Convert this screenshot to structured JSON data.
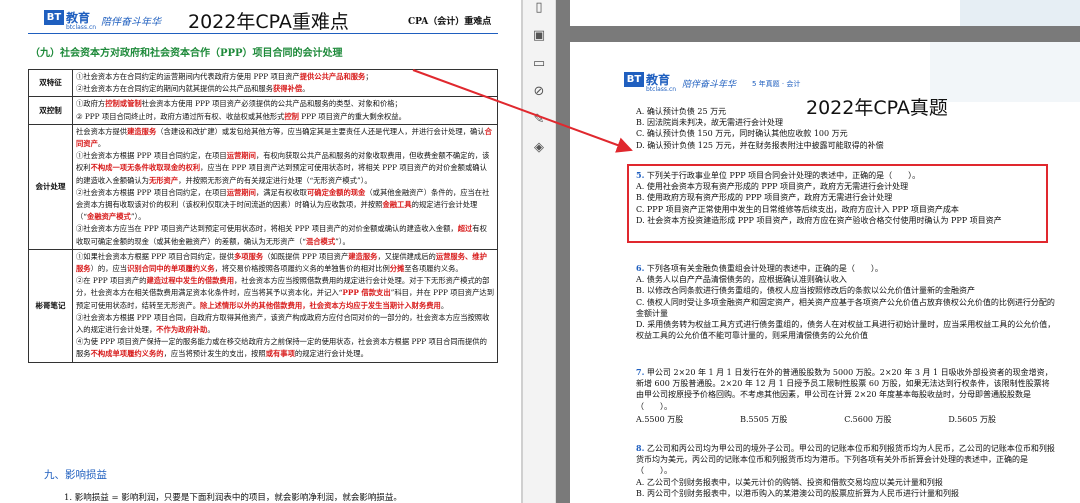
{
  "left_page": {
    "logo_mark": "BT",
    "logo_text": "教育",
    "logo_url": "btclass.cn",
    "slogan": "陪伴奋斗年华",
    "overlay_title": "2022年CPA重难点",
    "course_label": "CPA（会计）重难点",
    "section_title": "（九）社会资本方对政府和社会资本合作（PPP）项目合同的会计处理",
    "rows": [
      {
        "head": "双特征",
        "lines": [
          [
            {
              "t": "①社会资本方在合同约定的运营期间内代表政府方使用 PPP 项目资产"
            },
            {
              "t": "提供公共产品和服务",
              "r": true
            },
            {
              "t": "；"
            }
          ],
          [
            {
              "t": "②社会资本方在合同约定的期间内就其提供的公共产品和服务"
            },
            {
              "t": "获得补偿",
              "r": true
            },
            {
              "t": "。"
            }
          ]
        ]
      },
      {
        "head": "双控制",
        "lines": [
          [
            {
              "t": "①政府方"
            },
            {
              "t": "控制或管制",
              "r": true
            },
            {
              "t": "社会资本方使用 PPP 项目资产必须提供的公共产品和服务的类型、对象和价格；"
            }
          ],
          [
            {
              "t": "② PPP 项目合同终止时，政府方通过所有权、收益权或其他形式"
            },
            {
              "t": "控制",
              "r": true
            },
            {
              "t": " PPP 项目资产的重大剩余权益。"
            }
          ]
        ]
      },
      {
        "head": "会计处理",
        "lines": [
          [
            {
              "t": "社会资本方提供"
            },
            {
              "t": "建造服务",
              "r": true
            },
            {
              "t": "（含建设和改扩建）或发包给其他方等，应当确定其是主要责任人还是代理人，并进行会计处理，确认"
            },
            {
              "t": "合同资产",
              "r": true
            },
            {
              "t": "。"
            }
          ],
          [
            {
              "t": "①社会资本方根据 PPP 项目合同约定，在项目"
            },
            {
              "t": "运营期间",
              "r": true
            },
            {
              "t": "，有权向获取公共产品和服务的对象收取费用，但收费金额不确定的，该权利"
            },
            {
              "t": "不构成一项无条件收取现金的权利",
              "r": true
            },
            {
              "t": "，应当在 PPP 项目资产达到预定可使用状态时，将相关 PPP 项目资产的对价金额或确认的建造收入金额确认为"
            },
            {
              "t": "无形资产",
              "r": true
            },
            {
              "t": "，并按照无形资产的有关规定进行处理（“无形资产模式”）。"
            }
          ],
          [
            {
              "t": "②社会资本方根据 PPP 项目合同约定，在项目"
            },
            {
              "t": "运营期间",
              "r": true
            },
            {
              "t": "，满足有权收取"
            },
            {
              "t": "可确定金额的现金",
              "r": true
            },
            {
              "t": "（或其他金融资产）条件的，应当在社会资本方拥有收取该对价的权利（该权利仅取决于时间流逝的因素）时确认为应收款项，并按照"
            },
            {
              "t": "金融工具",
              "r": true
            },
            {
              "t": "的规定进行会计处理（“"
            },
            {
              "t": "金融资产模式",
              "r": true
            },
            {
              "t": "”）。"
            }
          ],
          [
            {
              "t": "③社会资本方应当在 PPP 项目资产达到预定可使用状态时，将相关 PPP 项目资产的对价金额或确认的建造收入金额，"
            },
            {
              "t": "超过",
              "r": true
            },
            {
              "t": "有权收取可确定金额的现金（或其他金融资产）的差额，确认为无形资产（“"
            },
            {
              "t": "混合模式",
              "r": true
            },
            {
              "t": "”）。"
            }
          ]
        ]
      },
      {
        "head": "彬哥笔记",
        "lines": [
          [
            {
              "t": "①如果社会资本方根据 PPP 项目合同约定，提供"
            },
            {
              "t": "多项服务",
              "r": true
            },
            {
              "t": "（如既提供 PPP 项目资产"
            },
            {
              "t": "建造服务",
              "r": true
            },
            {
              "t": "，又提供建成后的"
            },
            {
              "t": "运营服务、维护服务",
              "r": true
            },
            {
              "t": "）的，应当"
            },
            {
              "t": "识别合同中的单项履约义务",
              "r": true
            },
            {
              "t": "，将交易价格按照各项履约义务的单独售价的相对比例"
            },
            {
              "t": "分摊",
              "r": true
            },
            {
              "t": "至各项履约义务。"
            }
          ],
          [
            {
              "t": "②在 PPP 项目资产的"
            },
            {
              "t": "建造过程中发生的借款费用",
              "r": true
            },
            {
              "t": "，社会资本方应当按照借款费用的规定进行会计处理。对于下无形资产模式的部分，社会资本方在相关借款费用满足资本化条件时，应当将其予以资本化，并记入“"
            },
            {
              "t": "PPP 借款支出",
              "r": true
            },
            {
              "t": "”科目，并在 PPP 项目资产达到预定可使用状态时，结转至无形资产。"
            },
            {
              "t": "除上述情形以外的其他借款费用，社会资本方均应于发生当期计入财务费用",
              "r": true
            },
            {
              "t": "。"
            }
          ],
          [
            {
              "t": "③社会资本方根据 PPP 项目合同，自政府方取得其他资产，该资产构成政府方应付合同对价的一部分的，社会资本方应当按照收入的规定进行会计处理，"
            },
            {
              "t": "不作为政府补助",
              "r": true
            },
            {
              "t": "。"
            }
          ],
          [
            {
              "t": "④为使 PPP 项目资产保持一定的服务能力或在移交给政府方之前保持一定的使用状态，社会资本方根据 PPP 项目合同而提供的服务"
            },
            {
              "t": "不构成单项履约义务的",
              "r": true
            },
            {
              "t": "，应当将预计发生的支出，按照"
            },
            {
              "t": "或有事项",
              "r": true
            },
            {
              "t": "的规定进行会计处理。"
            }
          ]
        ]
      }
    ],
    "section9_title": "九、影响损益",
    "section9_item1": "1. 影响损益 = 影响利润，只要是下面利润表中的项目，就会影响净利润，就会影响损益。"
  },
  "toolbar": {
    "icons": [
      "bookmark-icon",
      "pages-icon",
      "comment-icon",
      "attachment-icon",
      "signature-icon",
      "layers-icon"
    ]
  },
  "right_page": {
    "logo_mark": "BT",
    "logo_text": "教育",
    "logo_url": "btclass.cn",
    "slogan": "陪伴奋斗年华",
    "header_suffix": "5 年真题 · 会计",
    "overlay_title": "2022年CPA真题",
    "prev_options": [
      "A. 确认预计负债 25 万元",
      "B. 因法院尚未判决，故无需进行会计处理",
      "C. 确认预计负债 150 万元，同时确认其他应收款 100 万元",
      "D. 确认预计负债 125 万元，并在财务报表附注中披露可能取得的补偿"
    ],
    "q5": {
      "num": "5.",
      "stem": "下列关于行政事业单位 PPP 项目合同会计处理的表述中，正确的是（　　）。",
      "options": [
        "A. 使用社会资本方现有资产形成的 PPP 项目资产，政府方无需进行会计处理",
        "B. 使用政府方现有资产形成的 PPP 项目资产，政府方无需进行会计处理",
        "C. PPP 项目资产正常使用中发生的日常维修等后续支出，政府方应计入 PPP 项目资产成本",
        "D. 社会资本方投资建造形成 PPP 项目资产，政府方应在资产验收合格交付使用时确认为 PPP 项目资产"
      ]
    },
    "q6": {
      "num": "6.",
      "stem": "下列各项有关金融负债重组会计处理的表述中，正确的是（　　）。",
      "options": [
        "A. 债务人以自产产品清偿债务的，应根据确认准则确认收入",
        "B. 以修改合同条款进行债务重组的，债权人应当按照修改后的条款以公允价值计量新的金融资产",
        "C. 债权人同时受让多项金融资产和固定资产，相关资产应基于各项资产公允价值占放弃债权公允价值的比例进行分配的金额计量",
        "D. 采用债务转为权益工具方式进行债务重组的，债务人在对权益工具进行初始计量时，应当采用权益工具的公允价值，权益工具的公允价值不能可靠计量的，则采用清偿债务的公允价值"
      ]
    },
    "q7": {
      "num": "7.",
      "stem": "甲公司 2×20 年 1 月 1 日发行在外的普通股股数为 5000 万股。2×20 年 3 月 1 日吸收外部投资者的现金增资，新增 600 万股普通股。2×20 年 12 月 1 日授予员工限制性股票 60 万股，如果无法达到行权条件，该限制性股票将由甲公司按原授予价格回购。不考虑其他因素，甲公司在计算 2×20 年度基本每股收益时，分母即普通股股数是（　　）。",
      "options": [
        "A.5500 万股",
        "B.5505 万股",
        "C.5600 万股",
        "D.5605 万股"
      ]
    },
    "q8": {
      "num": "8.",
      "stem": "乙公司和丙公司均为甲公司的境外子公司。甲公司的记账本位币和列报货币均为人民币，乙公司的记账本位币和列报货币均为美元，丙公司的记账本位币和列报货币均为港币。下列各项有关外币折算会计处理的表述中，正确的是（　　）。",
      "options": [
        "A. 乙公司个别财务报表中，以美元计价的购销、投资和借款交易均应以美元计量和列报",
        "B. 丙公司个别财务报表中，以港币购入的某港澳公司的股票应折算为人民币进行计量和列报"
      ]
    }
  },
  "colors": {
    "brand": "#1f5fbf",
    "accent_red": "#e0282e",
    "section_green": "#1e8a3a"
  }
}
